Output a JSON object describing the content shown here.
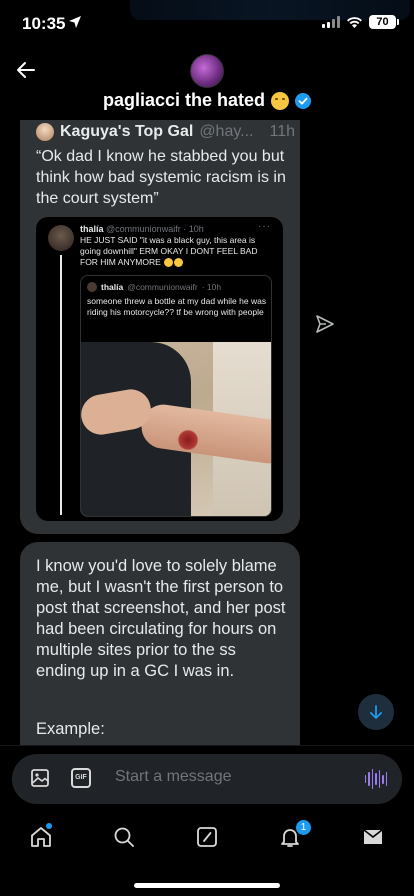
{
  "status_bar": {
    "time": "10:35",
    "battery": "70"
  },
  "header": {
    "display_name": "pagliacci the hated",
    "back_icon": "arrow-left-icon",
    "verified_color": "#1d9bf0"
  },
  "messages": [
    {
      "type": "shared_post",
      "quoted_name": "Kaguya's Top Gal",
      "quoted_handle": "@hay...",
      "quoted_time": "11h",
      "quoted_text": "“Ok dad I know he stabbed you but think how bad systemic racism is in the court system”",
      "embed": {
        "name": "thalía",
        "handle": "@communionwaifr",
        "time": "· 10h",
        "text": "HE JUST SAID \"it was a black guy, this area is going downhill\" ERM OKAY I DONT FEEL BAD FOR HIM ANYMORE",
        "inner": {
          "name": "thalía",
          "handle": "@communionwaifr",
          "time": "· 10h",
          "text": "someone threw a bottle at my dad while he was riding his motorcycle?? tf be wrong with people"
        }
      }
    },
    {
      "type": "text",
      "text": "I know you'd love to solely blame me, but I wasn't the first person to post that screenshot, and her post had been circulating for hours on multiple sites prior to the ss ending up in a GC I was in.",
      "text2": "Example:"
    }
  ],
  "composer": {
    "placeholder": "Start a message",
    "gif_label": "GIF",
    "voice_color": "#9b7bf2"
  },
  "tabbar": {
    "items": [
      "home-icon",
      "search-icon",
      "compose-icon",
      "notifications-icon",
      "messages-icon"
    ],
    "notification_count": "1",
    "accent": "#1d9bf0"
  }
}
